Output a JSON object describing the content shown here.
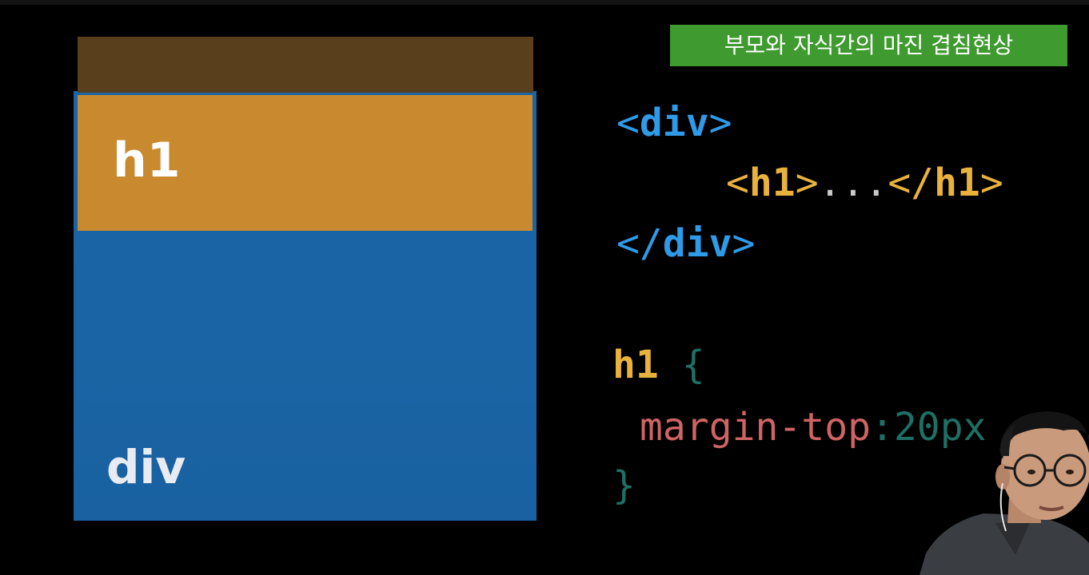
{
  "caption": "부모와 자식간의 마진 겹침현상",
  "diagram": {
    "h1_label": "h1",
    "div_label": "div"
  },
  "code": {
    "div_open": "div",
    "h1_open": "h1",
    "ellipsis": "...",
    "h1_close": "h1",
    "div_close": "div",
    "selector": "h1",
    "open_brace": "{",
    "property": "margin-top",
    "colon": ":",
    "value": "20px",
    "close_brace": "}"
  },
  "colors": {
    "margin_area": "#5a3f1d",
    "h1_box": "#c9892f",
    "div_box": "#1a65a6",
    "caption_bg": "#3f9a2f",
    "tag_blue": "#2f9be8",
    "tag_yellow": "#e9b23c",
    "property_red": "#d06464",
    "value_teal": "#1f6f64"
  }
}
